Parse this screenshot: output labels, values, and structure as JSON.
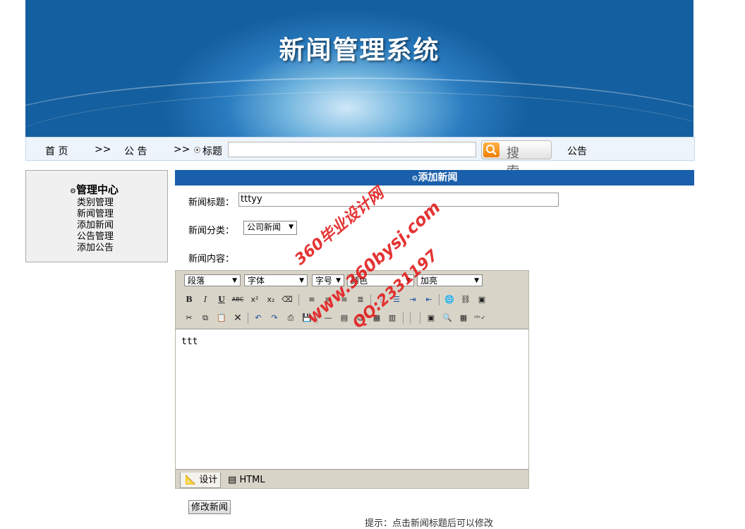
{
  "banner": {
    "title": "新闻管理系统"
  },
  "nav": {
    "home": "首  页",
    "sep1": ">>",
    "notice": "公  告",
    "sep2": ">>",
    "radio_label": "标题",
    "search_value": "",
    "search_button": "搜 索",
    "notice_right": "公告"
  },
  "sidebar": {
    "title": "管理中心",
    "items": [
      "类别管理",
      "新闻管理",
      "添加新闻",
      "公告管理",
      "添加公告"
    ]
  },
  "form": {
    "header": "添加新闻",
    "title_label": "新闻标题：",
    "title_value": "tttyy",
    "category_label": "新闻分类：",
    "category_value": "公司新闻",
    "content_label": "新闻内容："
  },
  "editor": {
    "selects": [
      "段落",
      "字体",
      "字号",
      "颜色",
      "加亮"
    ],
    "content": "ttt",
    "tab_design": "设计",
    "tab_html": "HTML"
  },
  "submit_label": "修改新闻",
  "hint": "提示：点击新闻标题后可以修改",
  "watermark": {
    "line1": "360毕业设计网",
    "line2": "www.360bysj.com",
    "line3": "QQ:2331197"
  },
  "colors": {
    "header_bg": "#1a5fab",
    "banner": "#145f9f",
    "nav_bg": "#eef4fb"
  }
}
